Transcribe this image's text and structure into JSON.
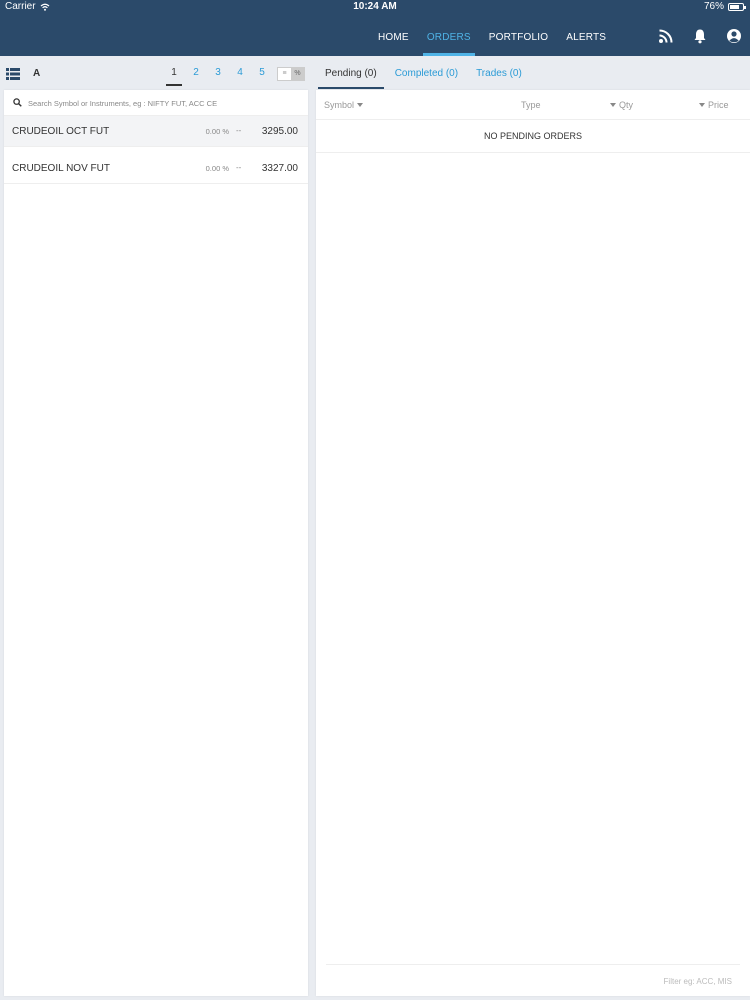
{
  "status_bar": {
    "carrier": "Carrier",
    "time": "10:24 AM",
    "battery": "76%",
    "battery_level": 0.76
  },
  "nav": {
    "links": [
      {
        "label": "HOME",
        "active": false
      },
      {
        "label": "ORDERS",
        "active": true
      },
      {
        "label": "PORTFOLIO",
        "active": false
      },
      {
        "label": "ALERTS",
        "active": false
      }
    ],
    "icons": [
      "rss-icon",
      "bell-icon",
      "user-icon"
    ],
    "accent": "#4fb3e6",
    "bg": "#2b4a6a"
  },
  "watchlist": {
    "group_label": "A",
    "pages": [
      "1",
      "2",
      "3",
      "4",
      "5"
    ],
    "active_page": "1",
    "search_placeholder": "Search Symbol or Instruments, eg : NIFTY FUT, ACC CE",
    "rows": [
      {
        "symbol": "CRUDEOIL OCT FUT",
        "change_pct": "0.00 %",
        "change": "--",
        "price": "3295.00",
        "selected": true
      },
      {
        "symbol": "CRUDEOIL NOV FUT",
        "change_pct": "0.00 %",
        "change": "--",
        "price": "3327.00",
        "selected": false
      }
    ]
  },
  "orders": {
    "tabs": [
      {
        "label": "Pending (0)",
        "active": true
      },
      {
        "label": "Completed (0)",
        "active": false
      },
      {
        "label": "Trades (0)",
        "active": false
      }
    ],
    "columns": {
      "symbol": "Symbol",
      "type": "Type",
      "qty": "Qty",
      "price": "Price"
    },
    "empty_message": "NO PENDING ORDERS",
    "filter_placeholder": "Filter eg: ACC, MIS"
  }
}
